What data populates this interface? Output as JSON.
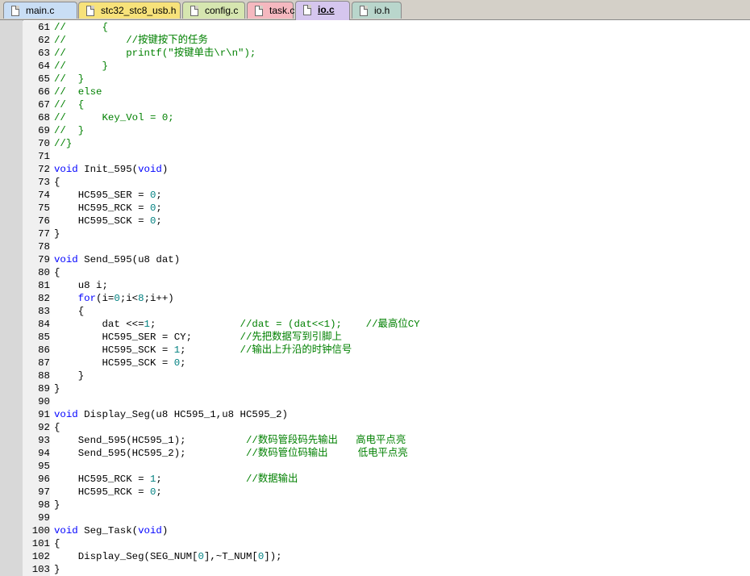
{
  "tabs": [
    {
      "label": "main.c",
      "color": "#c9def5",
      "active": false
    },
    {
      "label": "stc32_stc8_usb.h",
      "color": "#f7e27a",
      "active": false
    },
    {
      "label": "config.c",
      "color": "#d6e6b0",
      "active": false
    },
    {
      "label": "task.c",
      "color": "#f5b8bf",
      "active": false
    },
    {
      "label": "io.c",
      "color": "#d5c6ee",
      "active": true
    },
    {
      "label": "io.h",
      "color": "#b9d6cc",
      "active": false
    }
  ],
  "colors": {
    "comment": "#008000",
    "keyword": "#0000ff",
    "number": "#008080"
  },
  "lines": [
    {
      "n": "61",
      "t": [
        [
          "c",
          "//      {"
        ]
      ]
    },
    {
      "n": "62",
      "t": [
        [
          "c",
          "//          //按键按下的任务"
        ]
      ]
    },
    {
      "n": "63",
      "t": [
        [
          "c",
          "//          printf(\"按键单击\\r\\n\");"
        ]
      ]
    },
    {
      "n": "64",
      "t": [
        [
          "c",
          "//      }"
        ]
      ]
    },
    {
      "n": "65",
      "t": [
        [
          "c",
          "//  }"
        ]
      ]
    },
    {
      "n": "66",
      "t": [
        [
          "c",
          "//  else"
        ]
      ]
    },
    {
      "n": "67",
      "t": [
        [
          "c",
          "//  {"
        ]
      ]
    },
    {
      "n": "68",
      "t": [
        [
          "c",
          "//      Key_Vol = 0;"
        ]
      ]
    },
    {
      "n": "69",
      "t": [
        [
          "c",
          "//  }"
        ]
      ]
    },
    {
      "n": "70",
      "t": [
        [
          "c",
          "//}"
        ]
      ]
    },
    {
      "n": "71",
      "t": []
    },
    {
      "n": "72",
      "t": [
        [
          "k",
          "void"
        ],
        [
          "p",
          " Init_595("
        ],
        [
          "k",
          "void"
        ],
        [
          "p",
          ")"
        ]
      ]
    },
    {
      "n": "73",
      "t": [
        [
          "p",
          "{"
        ]
      ]
    },
    {
      "n": "74",
      "t": [
        [
          "p",
          "    HC595_SER = "
        ],
        [
          "d",
          "0"
        ],
        [
          "p",
          ";"
        ]
      ]
    },
    {
      "n": "75",
      "t": [
        [
          "p",
          "    HC595_RCK = "
        ],
        [
          "d",
          "0"
        ],
        [
          "p",
          ";"
        ]
      ]
    },
    {
      "n": "76",
      "t": [
        [
          "p",
          "    HC595_SCK = "
        ],
        [
          "d",
          "0"
        ],
        [
          "p",
          ";"
        ]
      ]
    },
    {
      "n": "77",
      "t": [
        [
          "p",
          "}"
        ]
      ]
    },
    {
      "n": "78",
      "t": []
    },
    {
      "n": "79",
      "t": [
        [
          "k",
          "void"
        ],
        [
          "p",
          " Send_595(u8 dat)"
        ]
      ]
    },
    {
      "n": "80",
      "t": [
        [
          "p",
          "{"
        ]
      ]
    },
    {
      "n": "81",
      "t": [
        [
          "p",
          "    u8 i;"
        ]
      ]
    },
    {
      "n": "82",
      "t": [
        [
          "p",
          "    "
        ],
        [
          "k",
          "for"
        ],
        [
          "p",
          "(i="
        ],
        [
          "d",
          "0"
        ],
        [
          "p",
          ";i<"
        ],
        [
          "d",
          "8"
        ],
        [
          "p",
          ";i++)"
        ]
      ]
    },
    {
      "n": "83",
      "t": [
        [
          "p",
          "    {"
        ]
      ]
    },
    {
      "n": "84",
      "t": [
        [
          "p",
          "        dat <<="
        ],
        [
          "d",
          "1"
        ],
        [
          "p",
          ";              "
        ],
        [
          "c",
          "//dat = (dat<<1);    //最高位CY"
        ]
      ]
    },
    {
      "n": "85",
      "t": [
        [
          "p",
          "        HC595_SER = CY;        "
        ],
        [
          "c",
          "//先把数据写到引脚上"
        ]
      ]
    },
    {
      "n": "86",
      "t": [
        [
          "p",
          "        HC595_SCK = "
        ],
        [
          "d",
          "1"
        ],
        [
          "p",
          ";         "
        ],
        [
          "c",
          "//输出上升沿的时钟信号"
        ]
      ]
    },
    {
      "n": "87",
      "t": [
        [
          "p",
          "        HC595_SCK = "
        ],
        [
          "d",
          "0"
        ],
        [
          "p",
          ";"
        ]
      ]
    },
    {
      "n": "88",
      "t": [
        [
          "p",
          "    }"
        ]
      ]
    },
    {
      "n": "89",
      "t": [
        [
          "p",
          "}"
        ]
      ]
    },
    {
      "n": "90",
      "t": []
    },
    {
      "n": "91",
      "t": [
        [
          "k",
          "void"
        ],
        [
          "p",
          " Display_Seg(u8 HC595_1,u8 HC595_2)"
        ]
      ]
    },
    {
      "n": "92",
      "t": [
        [
          "p",
          "{"
        ]
      ]
    },
    {
      "n": "93",
      "t": [
        [
          "p",
          "    Send_595(HC595_1);          "
        ],
        [
          "c",
          "//数码管段码先输出   高电平点亮"
        ]
      ]
    },
    {
      "n": "94",
      "t": [
        [
          "p",
          "    Send_595(HC595_2);          "
        ],
        [
          "c",
          "//数码管位码输出     低电平点亮"
        ]
      ]
    },
    {
      "n": "95",
      "t": []
    },
    {
      "n": "96",
      "t": [
        [
          "p",
          "    HC595_RCK = "
        ],
        [
          "d",
          "1"
        ],
        [
          "p",
          ";              "
        ],
        [
          "c",
          "//数据输出"
        ]
      ]
    },
    {
      "n": "97",
      "t": [
        [
          "p",
          "    HC595_RCK = "
        ],
        [
          "d",
          "0"
        ],
        [
          "p",
          ";"
        ]
      ]
    },
    {
      "n": "98",
      "t": [
        [
          "p",
          "}"
        ]
      ]
    },
    {
      "n": "99",
      "t": []
    },
    {
      "n": "100",
      "t": [
        [
          "k",
          "void"
        ],
        [
          "p",
          " Seg_Task("
        ],
        [
          "k",
          "void"
        ],
        [
          "p",
          ")"
        ]
      ]
    },
    {
      "n": "101",
      "t": [
        [
          "p",
          "{"
        ]
      ]
    },
    {
      "n": "102",
      "t": [
        [
          "p",
          "    Display_Seg(SEG_NUM["
        ],
        [
          "d",
          "0"
        ],
        [
          "p",
          "],~T_NUM["
        ],
        [
          "d",
          "0"
        ],
        [
          "p",
          "]);"
        ]
      ]
    },
    {
      "n": "103",
      "t": [
        [
          "p",
          "}"
        ]
      ]
    }
  ]
}
